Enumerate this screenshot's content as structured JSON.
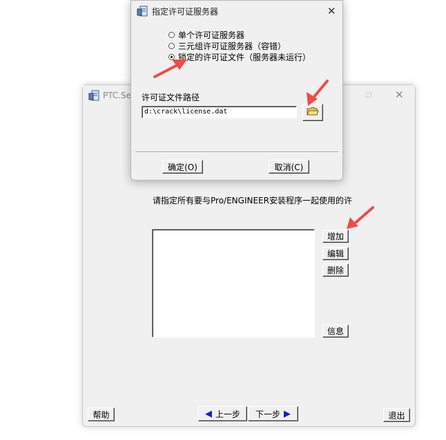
{
  "main_window": {
    "title": "PTC.Setu",
    "instruction": "请指定所有要与Pro/ENGINEER安装程序一起使用的许",
    "buttons": {
      "add": "增加",
      "edit": "编辑",
      "delete": "删除",
      "info": "信息",
      "help": "帮助",
      "back": "上一步",
      "next": "下一步",
      "exit": "退出"
    }
  },
  "dialog": {
    "title": "指定许可证服务器",
    "options": [
      {
        "label": "单个许可证服务器",
        "selected": false
      },
      {
        "label": "三元组许可证服务器（容错）",
        "selected": false
      },
      {
        "label": "锁定的许可证文件（服务器未运行）",
        "selected": true
      }
    ],
    "path_label": "许可证文件路径",
    "path_value": "d:\\crack\\license.dat",
    "ok_label": "确定(O)",
    "cancel_label": "取消(C)"
  },
  "annotations": {
    "arrow_color": "#f04a4a"
  }
}
